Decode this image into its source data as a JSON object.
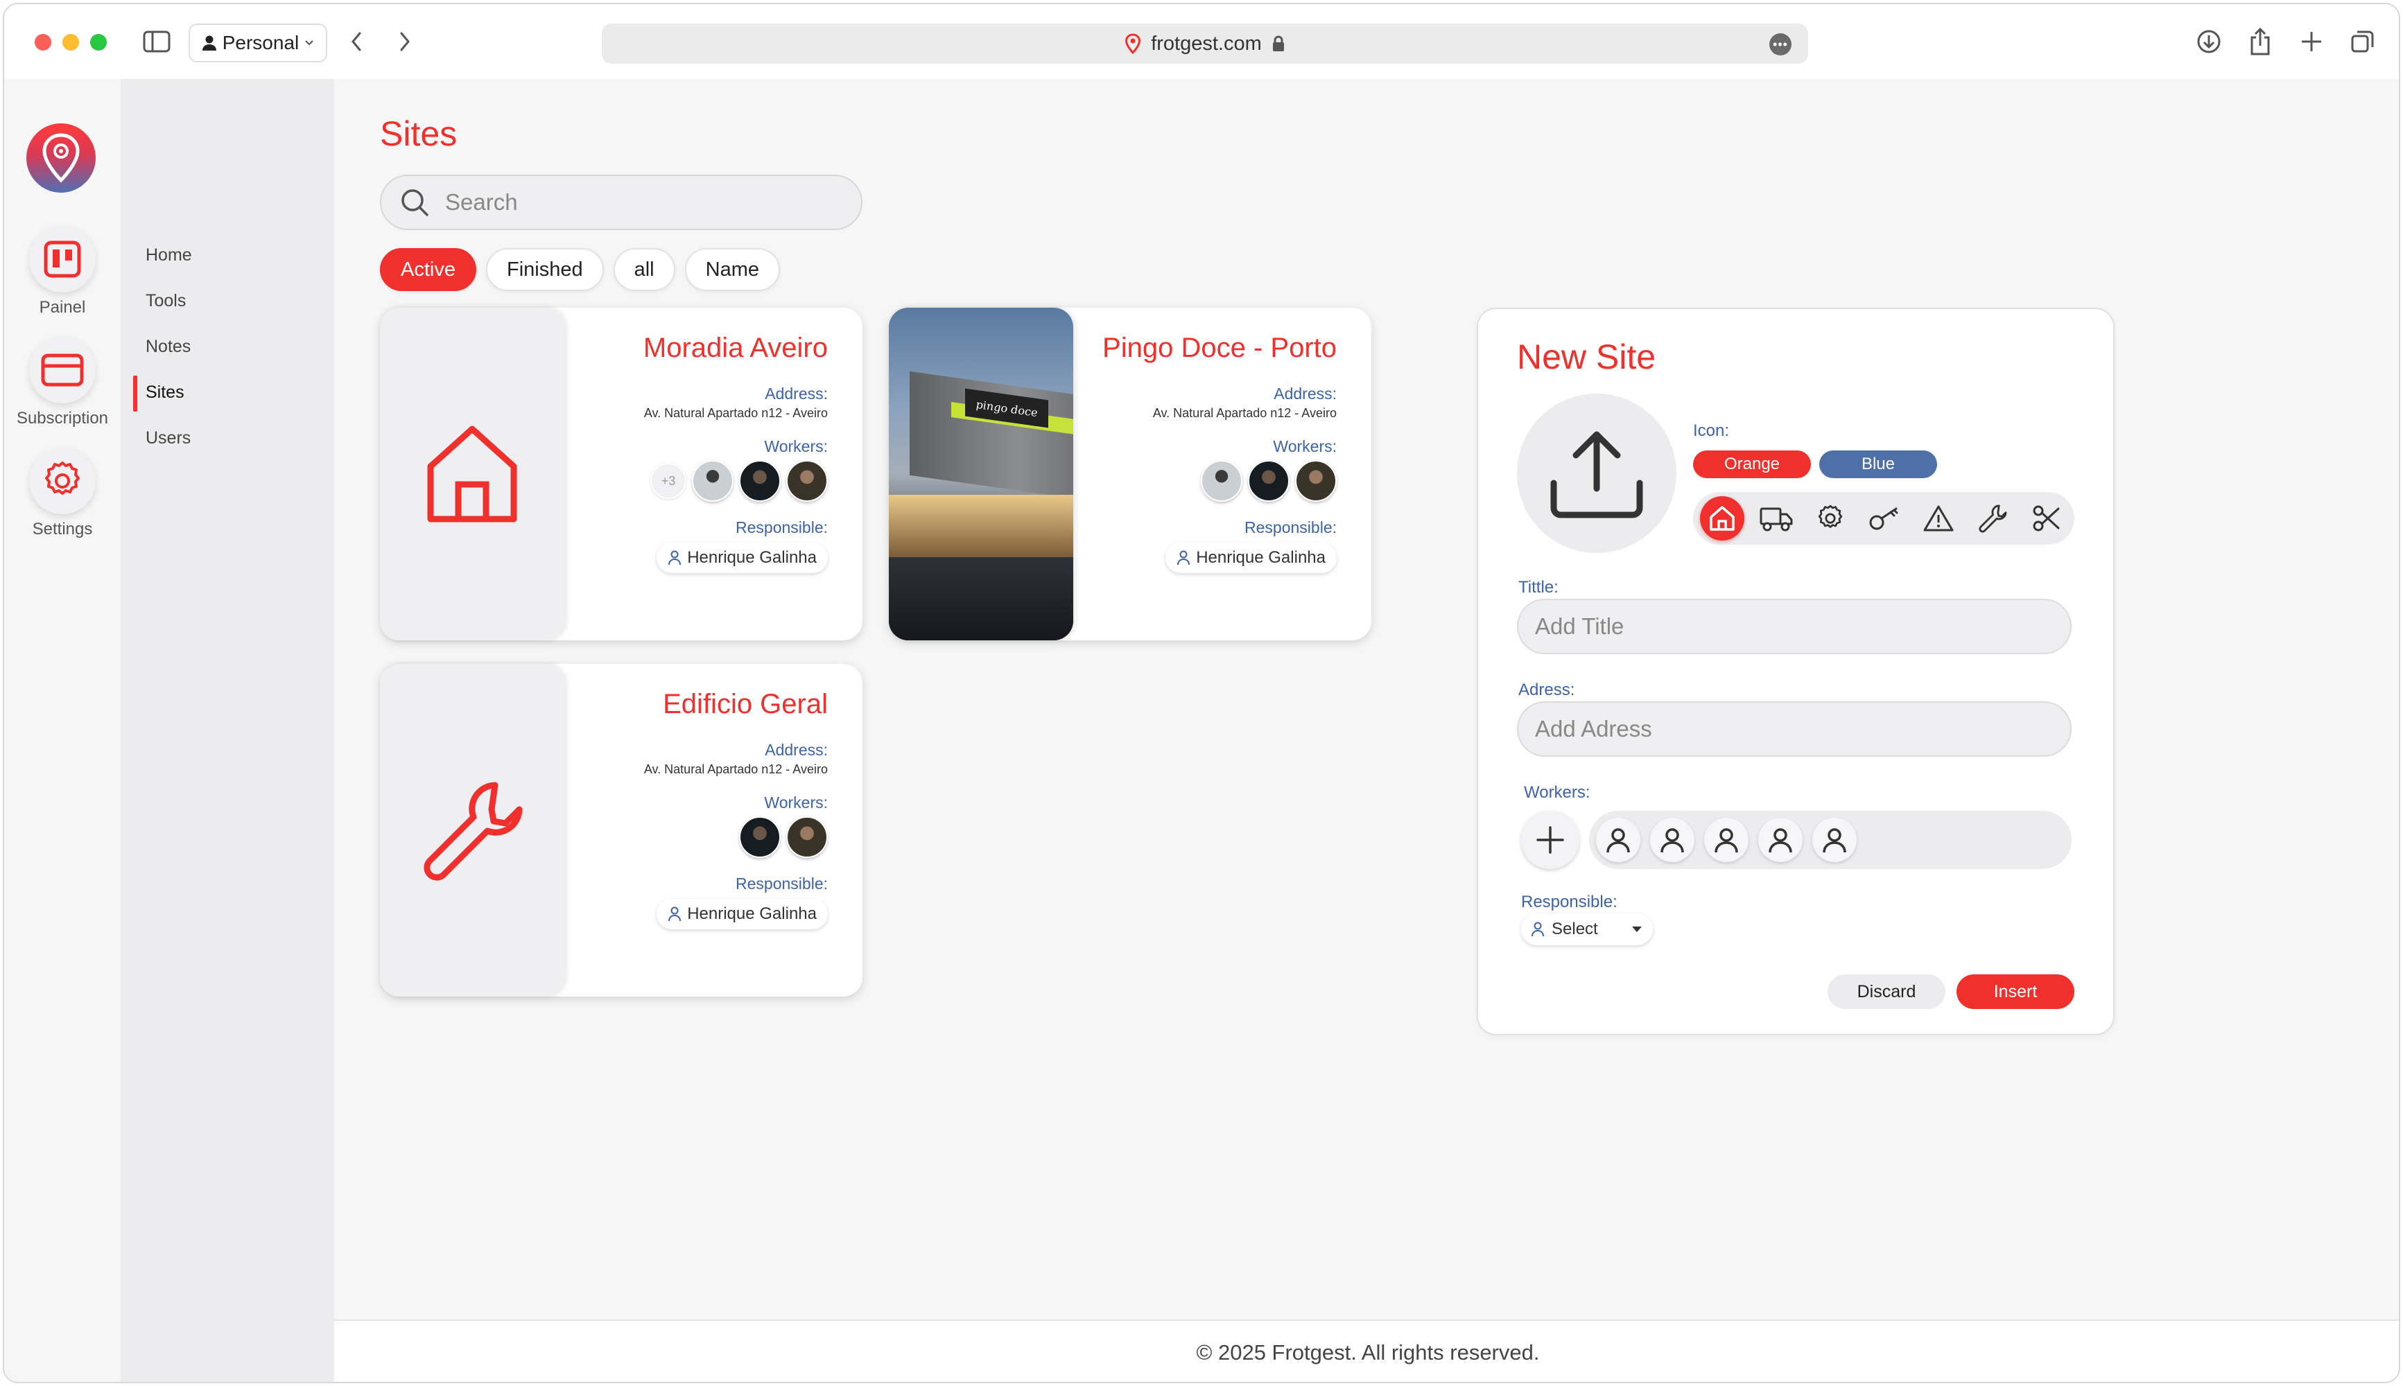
{
  "browser": {
    "profile_label": "Personal",
    "url": "frotgest.com"
  },
  "rail": {
    "items": [
      {
        "label": "Painel"
      },
      {
        "label": "Subscription"
      },
      {
        "label": "Settings"
      }
    ]
  },
  "subnav": {
    "items": [
      {
        "label": "Home"
      },
      {
        "label": "Tools"
      },
      {
        "label": "Notes"
      },
      {
        "label": "Sites"
      },
      {
        "label": "Users"
      }
    ],
    "active": "Sites"
  },
  "page": {
    "title": "Sites",
    "search_placeholder": "Search",
    "filters": [
      "Active",
      "Finished",
      "all",
      "Name"
    ],
    "active_filter": "Active"
  },
  "sites": [
    {
      "title": "Moradia Aveiro",
      "icon": "home-icon",
      "address_label": "Address:",
      "address": "Av. Natural Apartado n12 - Aveiro",
      "workers_label": "Workers:",
      "extra_workers": "+3",
      "responsible_label": "Responsible:",
      "responsible": "Henrique Galinha"
    },
    {
      "title": "Pingo Doce - Porto",
      "icon": "photo",
      "photo_sign": "pingo doce",
      "address_label": "Address:",
      "address": "Av. Natural Apartado n12 - Aveiro",
      "workers_label": "Workers:",
      "responsible_label": "Responsible:",
      "responsible": "Henrique Galinha"
    },
    {
      "title": "Edificio Geral",
      "icon": "wrench-icon",
      "address_label": "Address:",
      "address": "Av. Natural Apartado n12 - Aveiro",
      "workers_label": "Workers:",
      "responsible_label": "Responsible:",
      "responsible": "Henrique Galinha"
    }
  ],
  "new_site": {
    "title": "New Site",
    "icon_label": "Icon:",
    "colors": [
      "Orange",
      "Blue"
    ],
    "icon_options": [
      "home-icon",
      "truck-icon",
      "gear-icon",
      "key-icon",
      "warning-icon",
      "wrench-icon",
      "scissors-icon"
    ],
    "title_label": "Tittle:",
    "title_placeholder": "Add Title",
    "address_label": "Adress:",
    "address_placeholder": "Add Adress",
    "workers_label": "Workers:",
    "responsible_label": "Responsible:",
    "responsible_select": "Select",
    "discard": "Discard",
    "insert": "Insert"
  },
  "footer": "© 2025 Frotgest. All rights reserved.",
  "colors": {
    "accent": "#f0302c",
    "label_blue": "#3d62a8",
    "blue_pill": "#4f6fa8"
  }
}
